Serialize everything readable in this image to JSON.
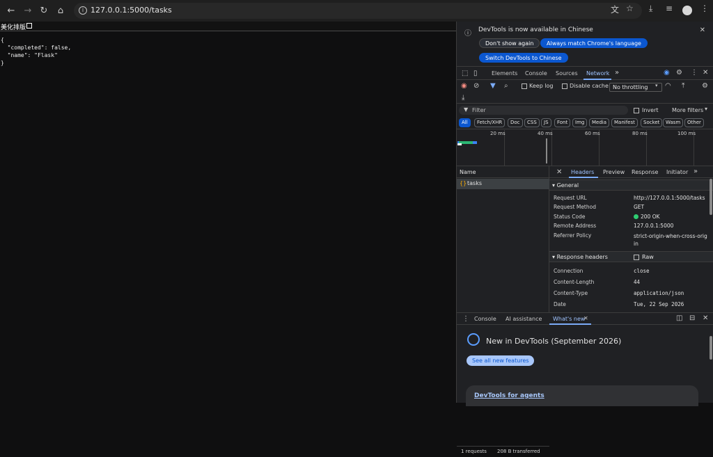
{
  "browser": {
    "url": "127.0.0.1:5000/tasks",
    "avatar_color": "#d8d8d8"
  },
  "page": {
    "pretty_label": "美化排版",
    "json_lines": [
      "{",
      "  \"completed\": false,",
      "  \"name\": \"Flask\"",
      "}"
    ]
  },
  "devtools": {
    "banner": {
      "text": "DevTools is now available in Chinese",
      "buttons": [
        "Don't show again",
        "Always match Chrome's language",
        "Switch DevTools to Chinese"
      ]
    },
    "tabs": [
      "Elements",
      "Console",
      "Sources",
      "Network"
    ],
    "toolbar": {
      "preserve_log": "Keep log",
      "disable_cache": "Disable cache",
      "throttling": "No throttling"
    },
    "filter": {
      "placeholder": "Filter",
      "invert": "Invert",
      "more_filters": "More filters"
    },
    "types": [
      "All",
      "Fetch/XHR",
      "Doc",
      "CSS",
      "JS",
      "Font",
      "Img",
      "Media",
      "Manifest",
      "Socket",
      "Wasm",
      "Other"
    ],
    "timeline_ticks": [
      "20 ms",
      "40 ms",
      "60 ms",
      "80 ms",
      "100 ms"
    ],
    "list": {
      "header": "Name",
      "items": [
        {
          "name": "tasks"
        }
      ],
      "footer_requests": "1 requests",
      "footer_transfer": "208 B transferred"
    },
    "details": {
      "tabs": [
        "Headers",
        "Preview",
        "Response",
        "Initiator"
      ],
      "general_title": "General",
      "general": [
        {
          "k": "Request URL",
          "v": "http://127.0.0.1:5000/tasks"
        },
        {
          "k": "Request Method",
          "v": "GET"
        },
        {
          "k": "Status Code",
          "v": "200 OK"
        },
        {
          "k": "Remote Address",
          "v": "127.0.0.1:5000"
        },
        {
          "k": "Referrer Policy",
          "v": "strict-origin-when-cross-origin"
        }
      ],
      "response_title": "Response headers",
      "raw": "Raw",
      "response": [
        {
          "k": "Connection",
          "v": "close"
        },
        {
          "k": "Content-Length",
          "v": "44"
        },
        {
          "k": "Content-Type",
          "v": "application/json"
        },
        {
          "k": "Date",
          "v": "Tue, 22 Sep 2026"
        }
      ]
    },
    "drawer": {
      "tabs": [
        "Console",
        "AI assistance",
        "What's new"
      ],
      "headline": "New in DevTools (September 2026)",
      "button": "See all new features",
      "card_link": "DevTools for agents"
    }
  }
}
